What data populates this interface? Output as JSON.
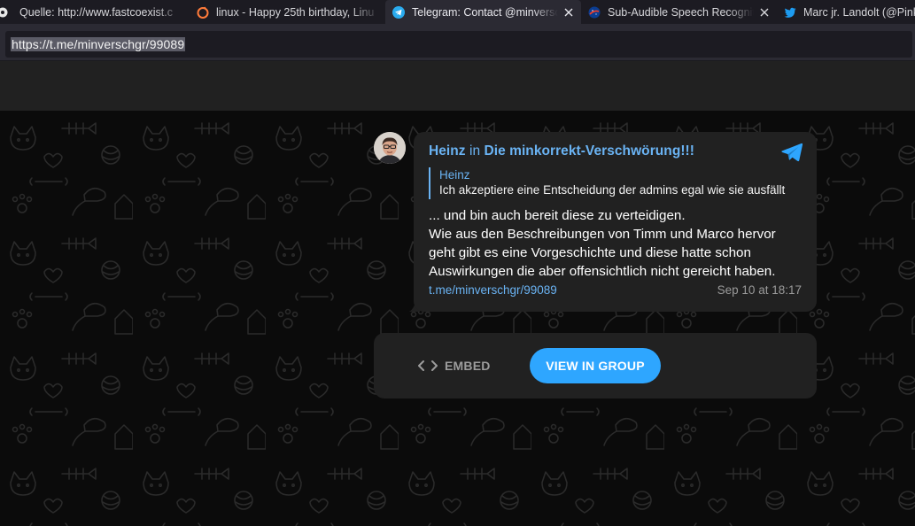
{
  "browser": {
    "tabs": [
      {
        "title": "Quelle: http://www.fastcoexist.c",
        "icon": "gear-favicon-icon",
        "active": false
      },
      {
        "title": "linux - Happy 25th birthday, Linu",
        "icon": "orange-favicon-icon",
        "active": false
      },
      {
        "title": "Telegram: Contact @minverschgr",
        "icon": "telegram-favicon-icon",
        "active": true
      },
      {
        "title": "Sub-Audible Speech Recognition",
        "icon": "nasa-favicon-icon",
        "active": false
      },
      {
        "title": "Marc jr. Landolt (@Pinkeye",
        "icon": "twitter-favicon-icon",
        "active": false
      }
    ],
    "url": "https://t.me/minverschgr/99089"
  },
  "message": {
    "author": "Heinz",
    "in_word": "in",
    "group": "Die minkorrekt-Verschwörung!!!",
    "reply": {
      "author": "Heinz",
      "text": "Ich akzeptiere eine Entscheidung der admins egal wie sie ausfällt"
    },
    "text_lines": [
      "... und bin auch bereit diese zu verteidigen.",
      "Wie aus den Beschreibungen von Timm und Marco hervor",
      "geht gibt es eine Vorgeschichte und diese hatte schon",
      "Auswirkungen die aber offensichtlich nicht gereicht haben."
    ],
    "link": "t.me/minverschgr/99089",
    "time": "Sep 10 at 18:17"
  },
  "actions": {
    "embed_label": "EMBED",
    "view_label": "VIEW IN GROUP"
  },
  "colors": {
    "accent": "#6ab3f3",
    "button": "#2ea6ff",
    "bubble": "#212121",
    "background": "#0b0b0b"
  }
}
